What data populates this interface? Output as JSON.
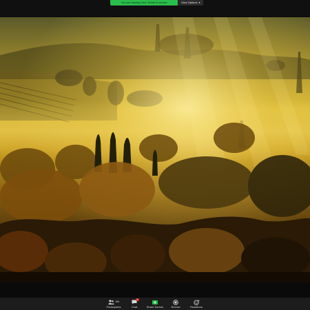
{
  "banner": {
    "share_notice": "You are viewing Your Screen's screen",
    "view_options_label": "View Options",
    "view_options_icon": "chevron-down-icon",
    "notice_color": "#2bbd4c"
  },
  "shared_content": {
    "description_icon": "landscape-photo"
  },
  "toolbar": {
    "participants": {
      "label": "Participants",
      "count": "166",
      "icon": "people-icon"
    },
    "chat": {
      "label": "Chat",
      "badge": "1",
      "icon": "chat-bubble-icon"
    },
    "share_screen": {
      "label": "Share Screen",
      "icon": "share-screen-icon",
      "color": "#2bbd4c"
    },
    "record": {
      "label": "Record",
      "icon": "record-icon"
    },
    "reactions": {
      "label": "Reactions",
      "icon": "smiley-plus-icon"
    }
  }
}
